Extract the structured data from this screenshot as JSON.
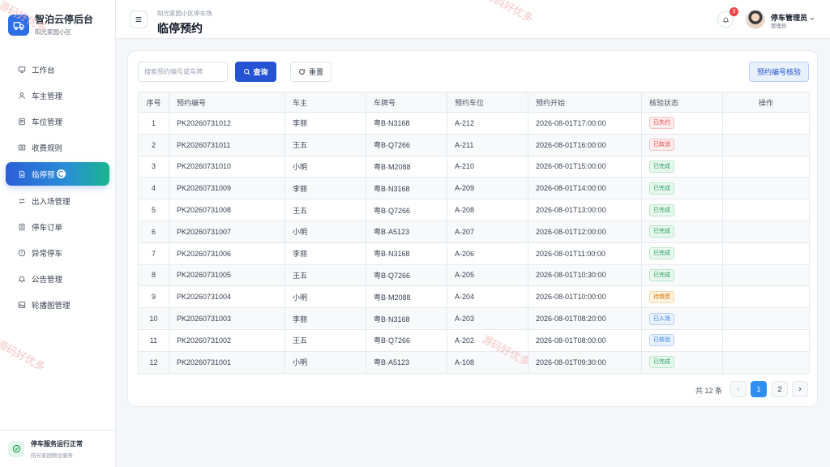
{
  "brand": {
    "title": "智泊云停后台",
    "subtitle": "阳光家园小区"
  },
  "sidebar": {
    "items": [
      {
        "label": "工作台",
        "icon": "monitor-icon"
      },
      {
        "label": "车主管理",
        "icon": "user-icon"
      },
      {
        "label": "车位管理",
        "icon": "car-icon"
      },
      {
        "label": "收费规则",
        "icon": "money-icon"
      },
      {
        "label": "临停预",
        "icon": "document-icon",
        "active": true
      },
      {
        "label": "出入场管理",
        "icon": "swap-icon"
      },
      {
        "label": "停车订单",
        "icon": "list-icon"
      },
      {
        "label": "异常停车",
        "icon": "alert-icon"
      },
      {
        "label": "公告管理",
        "icon": "bell-icon"
      },
      {
        "label": "轮播图管理",
        "icon": "image-icon"
      }
    ]
  },
  "system_status": {
    "title": "停车服务运行正常",
    "subtitle": "阳光家园物业服务"
  },
  "header": {
    "breadcrumb": "阳光家园小区停车场",
    "title": "临停预约",
    "notification_count": "3",
    "user_name": "停车管理员",
    "user_role": "管理员"
  },
  "toolbar": {
    "search_placeholder": "搜索预约编号或车牌",
    "search_value": "",
    "query_label": "查询",
    "reset_label": "重置",
    "verify_label": "预约编号核验"
  },
  "table": {
    "columns": [
      "序号",
      "预约编号",
      "车主",
      "车牌号",
      "预约车位",
      "预约开始",
      "核验状态",
      "操作"
    ],
    "rows": [
      [
        "1",
        "PK20260731012",
        "李丽",
        "粤B·N3168",
        "A-212",
        "2026-08-01T17:00:00",
        "已失约",
        ""
      ],
      [
        "2",
        "PK20260731011",
        "王五",
        "粤B·Q7266",
        "A-211",
        "2026-08-01T16:00:00",
        "已取消",
        ""
      ],
      [
        "3",
        "PK20260731010",
        "小明",
        "粤B·M2088",
        "A-210",
        "2026-08-01T15:00:00",
        "已完成",
        ""
      ],
      [
        "4",
        "PK20260731009",
        "李丽",
        "粤B·N3168",
        "A-209",
        "2026-08-01T14:00:00",
        "已完成",
        ""
      ],
      [
        "5",
        "PK20260731008",
        "王五",
        "粤B·Q7266",
        "A-208",
        "2026-08-01T13:00:00",
        "已完成",
        ""
      ],
      [
        "6",
        "PK20260731007",
        "小明",
        "粤B·A5123",
        "A-207",
        "2026-08-01T12:00:00",
        "已完成",
        ""
      ],
      [
        "7",
        "PK20260731006",
        "李丽",
        "粤B·N3168",
        "A-206",
        "2026-08-01T11:00:00",
        "已完成",
        ""
      ],
      [
        "8",
        "PK20260731005",
        "王五",
        "粤B·Q7266",
        "A-205",
        "2026-08-01T10:30:00",
        "已完成",
        ""
      ],
      [
        "9",
        "PK20260731004",
        "小明",
        "粤B·M2088",
        "A-204",
        "2026-08-01T10:00:00",
        "待缴费",
        ""
      ],
      [
        "10",
        "PK20260731003",
        "李丽",
        "粤B·N3168",
        "A-203",
        "2026-08-01T08:20:00",
        "已入场",
        ""
      ],
      [
        "11",
        "PK20260731002",
        "王五",
        "粤B·Q7266",
        "A-202",
        "2026-08-01T08:00:00",
        "已核验",
        ""
      ],
      [
        "12",
        "PK20260731001",
        "小明",
        "粤B·A5123",
        "A-108",
        "2026-08-01T09:30:00",
        "已完成",
        ""
      ]
    ]
  },
  "status_colors": {
    "已失约": {
      "fg": "#e5484d",
      "bg": "#fdecec",
      "border": "#f7c3c3"
    },
    "已取消": {
      "fg": "#e5484d",
      "bg": "#fdecec",
      "border": "#f7c3c3"
    },
    "已完成": {
      "fg": "#1f9d55",
      "bg": "#e8f7ee",
      "border": "#b9e6c9"
    },
    "待缴费": {
      "fg": "#d97706",
      "bg": "#fdf3e1",
      "border": "#f5d9a8"
    },
    "已入场": {
      "fg": "#2f7fe0",
      "bg": "#e8f1fd",
      "border": "#b9d3f6"
    },
    "已核验": {
      "fg": "#2f7fe0",
      "bg": "#e8f1fd",
      "border": "#b9d3f6"
    }
  },
  "pagination": {
    "total_text": "共 12 条",
    "pages": [
      "1",
      "2"
    ],
    "current": "1"
  },
  "watermark": {
    "text": "源码好优多"
  },
  "colors": {
    "primary": "#2454d3",
    "sidebar_active_start": "#2a5fd8",
    "sidebar_active_end": "#19b58d"
  }
}
